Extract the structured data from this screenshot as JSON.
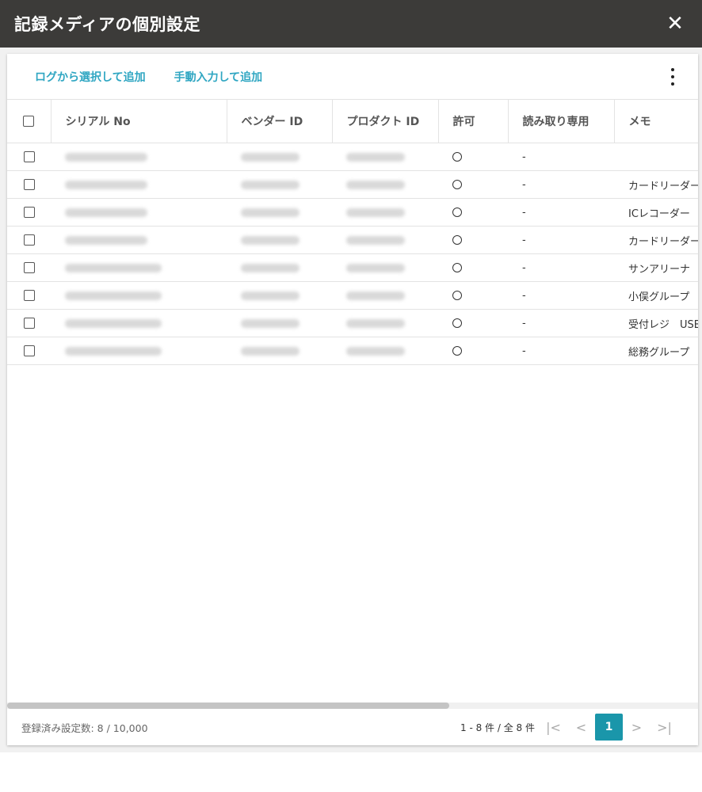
{
  "dialog": {
    "title": "記録メディアの個別設定",
    "close_glyph": "✕"
  },
  "toolbar": {
    "select_from_log": "ログから選択して追加",
    "manual_add": "手動入力して追加",
    "more_icon": "kebab-menu-icon"
  },
  "table": {
    "columns": [
      "シリアル No",
      "ベンダー ID",
      "プロダクト ID",
      "許可",
      "読み取り専用",
      "メモ"
    ],
    "rows": [
      {
        "allow": "〇",
        "readonly": "-",
        "memo": ""
      },
      {
        "allow": "〇",
        "readonly": "-",
        "memo": "カードリーダー"
      },
      {
        "allow": "〇",
        "readonly": "-",
        "memo": "ICレコーダー"
      },
      {
        "allow": "〇",
        "readonly": "-",
        "memo": "カードリーダー"
      },
      {
        "allow": "〇",
        "readonly": "-",
        "memo": "サンアリーナ"
      },
      {
        "allow": "〇",
        "readonly": "-",
        "memo": "小俣グループ"
      },
      {
        "allow": "〇",
        "readonly": "-",
        "memo": "受付レジ　USB"
      },
      {
        "allow": "〇",
        "readonly": "-",
        "memo": "総務グループ"
      }
    ]
  },
  "footer": {
    "registered_count": "登録済み設定数: 8 / 10,000",
    "range": "1 - 8 件 / 全 8 件",
    "first_glyph": "|<",
    "prev_glyph": "<",
    "current_page": "1",
    "next_glyph": ">",
    "last_glyph": ">|"
  },
  "colors": {
    "titlebar": "#3c3b39",
    "link": "#2fa6c2",
    "page_active": "#1a96aa"
  }
}
